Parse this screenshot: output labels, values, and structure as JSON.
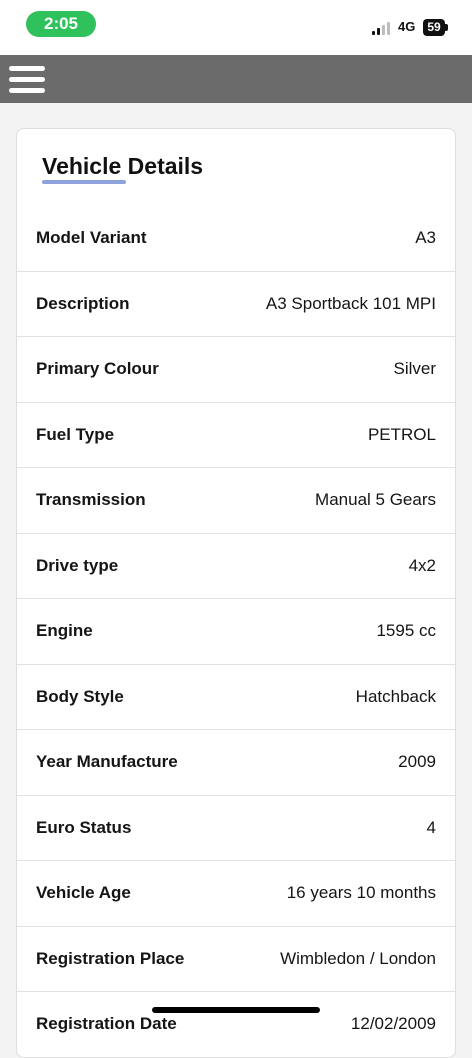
{
  "status_bar": {
    "time": "2:05",
    "network": "4G",
    "battery": "59"
  },
  "navbar": {
    "menu_icon": "hamburger-menu-icon"
  },
  "card": {
    "title": "Vehicle Details",
    "accent_color": "#8ea2dc",
    "rows": [
      {
        "label": "Model Variant",
        "value": "A3"
      },
      {
        "label": "Description",
        "value": "A3 Sportback 101 MPI"
      },
      {
        "label": "Primary Colour",
        "value": "Silver"
      },
      {
        "label": "Fuel Type",
        "value": "PETROL"
      },
      {
        "label": "Transmission",
        "value": "Manual 5 Gears"
      },
      {
        "label": "Drive type",
        "value": "4x2"
      },
      {
        "label": "Engine",
        "value": "1595 cc"
      },
      {
        "label": "Body Style",
        "value": "Hatchback"
      },
      {
        "label": "Year Manufacture",
        "value": "2009"
      },
      {
        "label": "Euro Status",
        "value": "4"
      },
      {
        "label": "Vehicle Age",
        "value": "16 years 10 months"
      },
      {
        "label": "Registration Place",
        "value": "Wimbledon / London"
      },
      {
        "label": "Registration Date",
        "value": "12/02/2009"
      }
    ]
  }
}
